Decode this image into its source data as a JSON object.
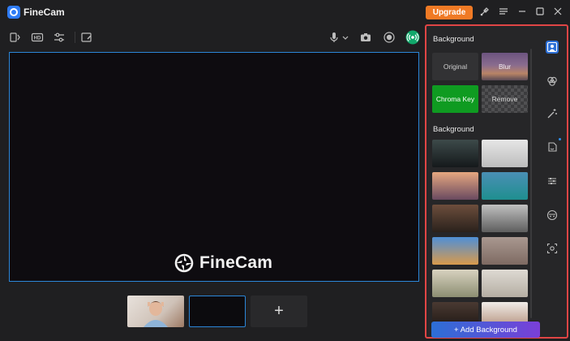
{
  "app": {
    "title": "FineCam"
  },
  "titlebar": {
    "upgrade_label": "Upgrade",
    "icons": [
      "brush-icon",
      "menu-icon",
      "minimize-icon",
      "maximize-icon",
      "close-icon"
    ]
  },
  "toolbar": {
    "left_icons": [
      "switch-camera-icon",
      "hd-icon",
      "settings-sliders-icon",
      "annotate-icon"
    ],
    "right_icons": [
      "microphone-icon",
      "chevron-down-icon",
      "camera-snapshot-icon",
      "record-icon",
      "live-broadcast-icon"
    ]
  },
  "preview": {
    "watermark": "FineCam"
  },
  "scenes": {
    "add_label": "+"
  },
  "panel": {
    "section1_title": "Background",
    "modes": [
      {
        "label": "Original"
      },
      {
        "label": "Blur"
      },
      {
        "label": "Chroma Key"
      },
      {
        "label": "Remove"
      }
    ],
    "section2_title": "Background",
    "backgrounds": [
      {
        "name": "living-room-dark",
        "color1": "#3d4a4a",
        "color2": "#15191b"
      },
      {
        "name": "white-wall",
        "color1": "#e6e6e6",
        "color2": "#bdbdbd"
      },
      {
        "name": "eiffel-tower-sunset",
        "color1": "#e6a780",
        "color2": "#6a4a60"
      },
      {
        "name": "mountain-lake",
        "color1": "#4a8fb5",
        "color2": "#1f8f8f"
      },
      {
        "name": "library-room",
        "color1": "#6d4e3c",
        "color2": "#2a211c"
      },
      {
        "name": "loft-interior",
        "color1": "#c0c0c0",
        "color2": "#5e5e5e"
      },
      {
        "name": "desert-dunes",
        "color1": "#4f8fd6",
        "color2": "#d89a4c"
      },
      {
        "name": "brick-wall",
        "color1": "#a99890",
        "color2": "#7e6a62"
      },
      {
        "name": "plant-corner",
        "color1": "#d8d2c0",
        "color2": "#8c8e72"
      },
      {
        "name": "frames-wall",
        "color1": "#dedad3",
        "color2": "#b5aea3"
      },
      {
        "name": "bookshelf",
        "color1": "#4a3a32",
        "color2": "#1c1512"
      },
      {
        "name": "person-portrait",
        "color1": "#f0ece8",
        "color2": "#b08a74"
      }
    ],
    "add_background_label": "+ Add Background",
    "sidebar_icons": [
      "portrait-icon",
      "filters-icon",
      "magic-wand-icon",
      "sticker-icon",
      "adjustments-icon",
      "face-mask-icon",
      "ai-scan-icon"
    ]
  },
  "colors": {
    "accent_blue": "#2b86d8",
    "upgrade_orange": "#f07a25",
    "chroma_green": "#0f9b21",
    "highlight_red": "#e04545"
  }
}
